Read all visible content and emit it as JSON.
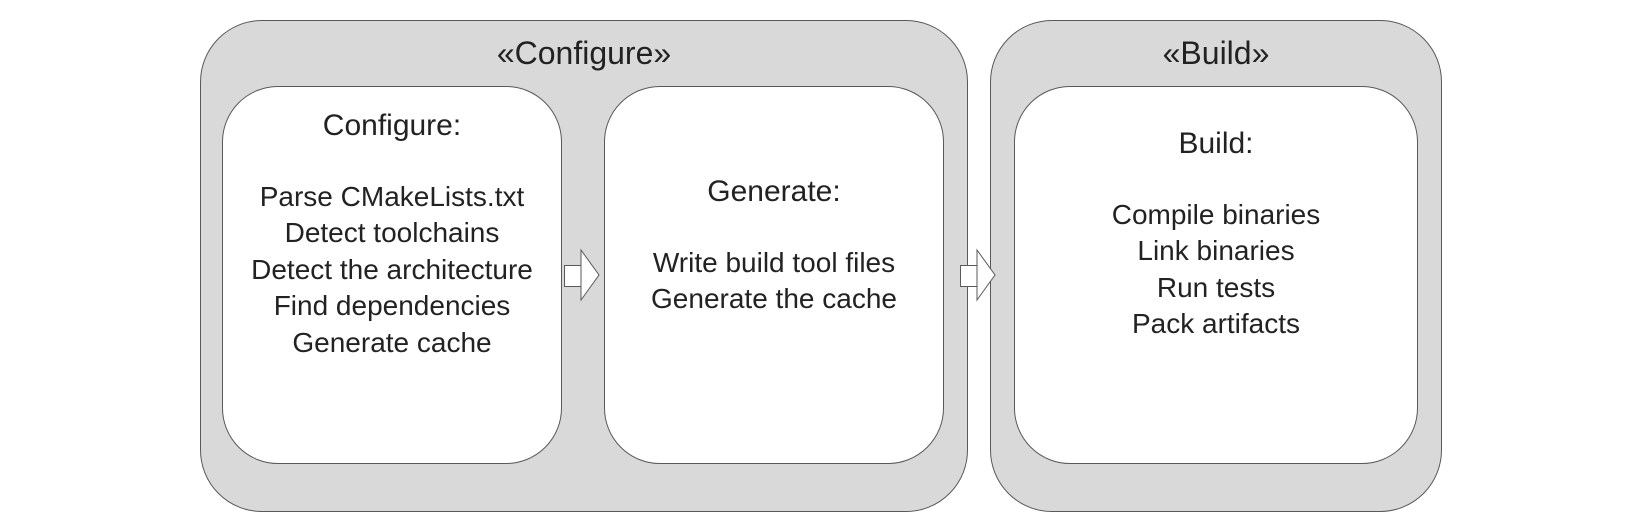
{
  "phases": [
    {
      "title": "«Configure»"
    },
    {
      "title": "«Build»"
    }
  ],
  "cards": [
    {
      "title": "Configure:",
      "items": [
        "Parse CMakeLists.txt",
        "Detect toolchains",
        "Detect the architecture",
        "Find dependencies",
        "Generate cache"
      ]
    },
    {
      "title": "Generate:",
      "items": [
        "Write build tool files",
        "Generate the cache"
      ]
    },
    {
      "title": "Build:",
      "items": [
        "Compile binaries",
        "Link binaries",
        "Run tests",
        "Pack artifacts"
      ]
    }
  ],
  "chart_data": {
    "type": "diagram",
    "description": "CMake build process phases",
    "phases": [
      {
        "name": "Configure",
        "steps": [
          {
            "name": "Configure",
            "actions": [
              "Parse CMakeLists.txt",
              "Detect toolchains",
              "Detect the architecture",
              "Find dependencies",
              "Generate cache"
            ]
          },
          {
            "name": "Generate",
            "actions": [
              "Write build tool files",
              "Generate the cache"
            ]
          }
        ]
      },
      {
        "name": "Build",
        "steps": [
          {
            "name": "Build",
            "actions": [
              "Compile binaries",
              "Link binaries",
              "Run tests",
              "Pack artifacts"
            ]
          }
        ]
      }
    ],
    "flow": [
      "Configure",
      "Generate",
      "Build"
    ]
  }
}
